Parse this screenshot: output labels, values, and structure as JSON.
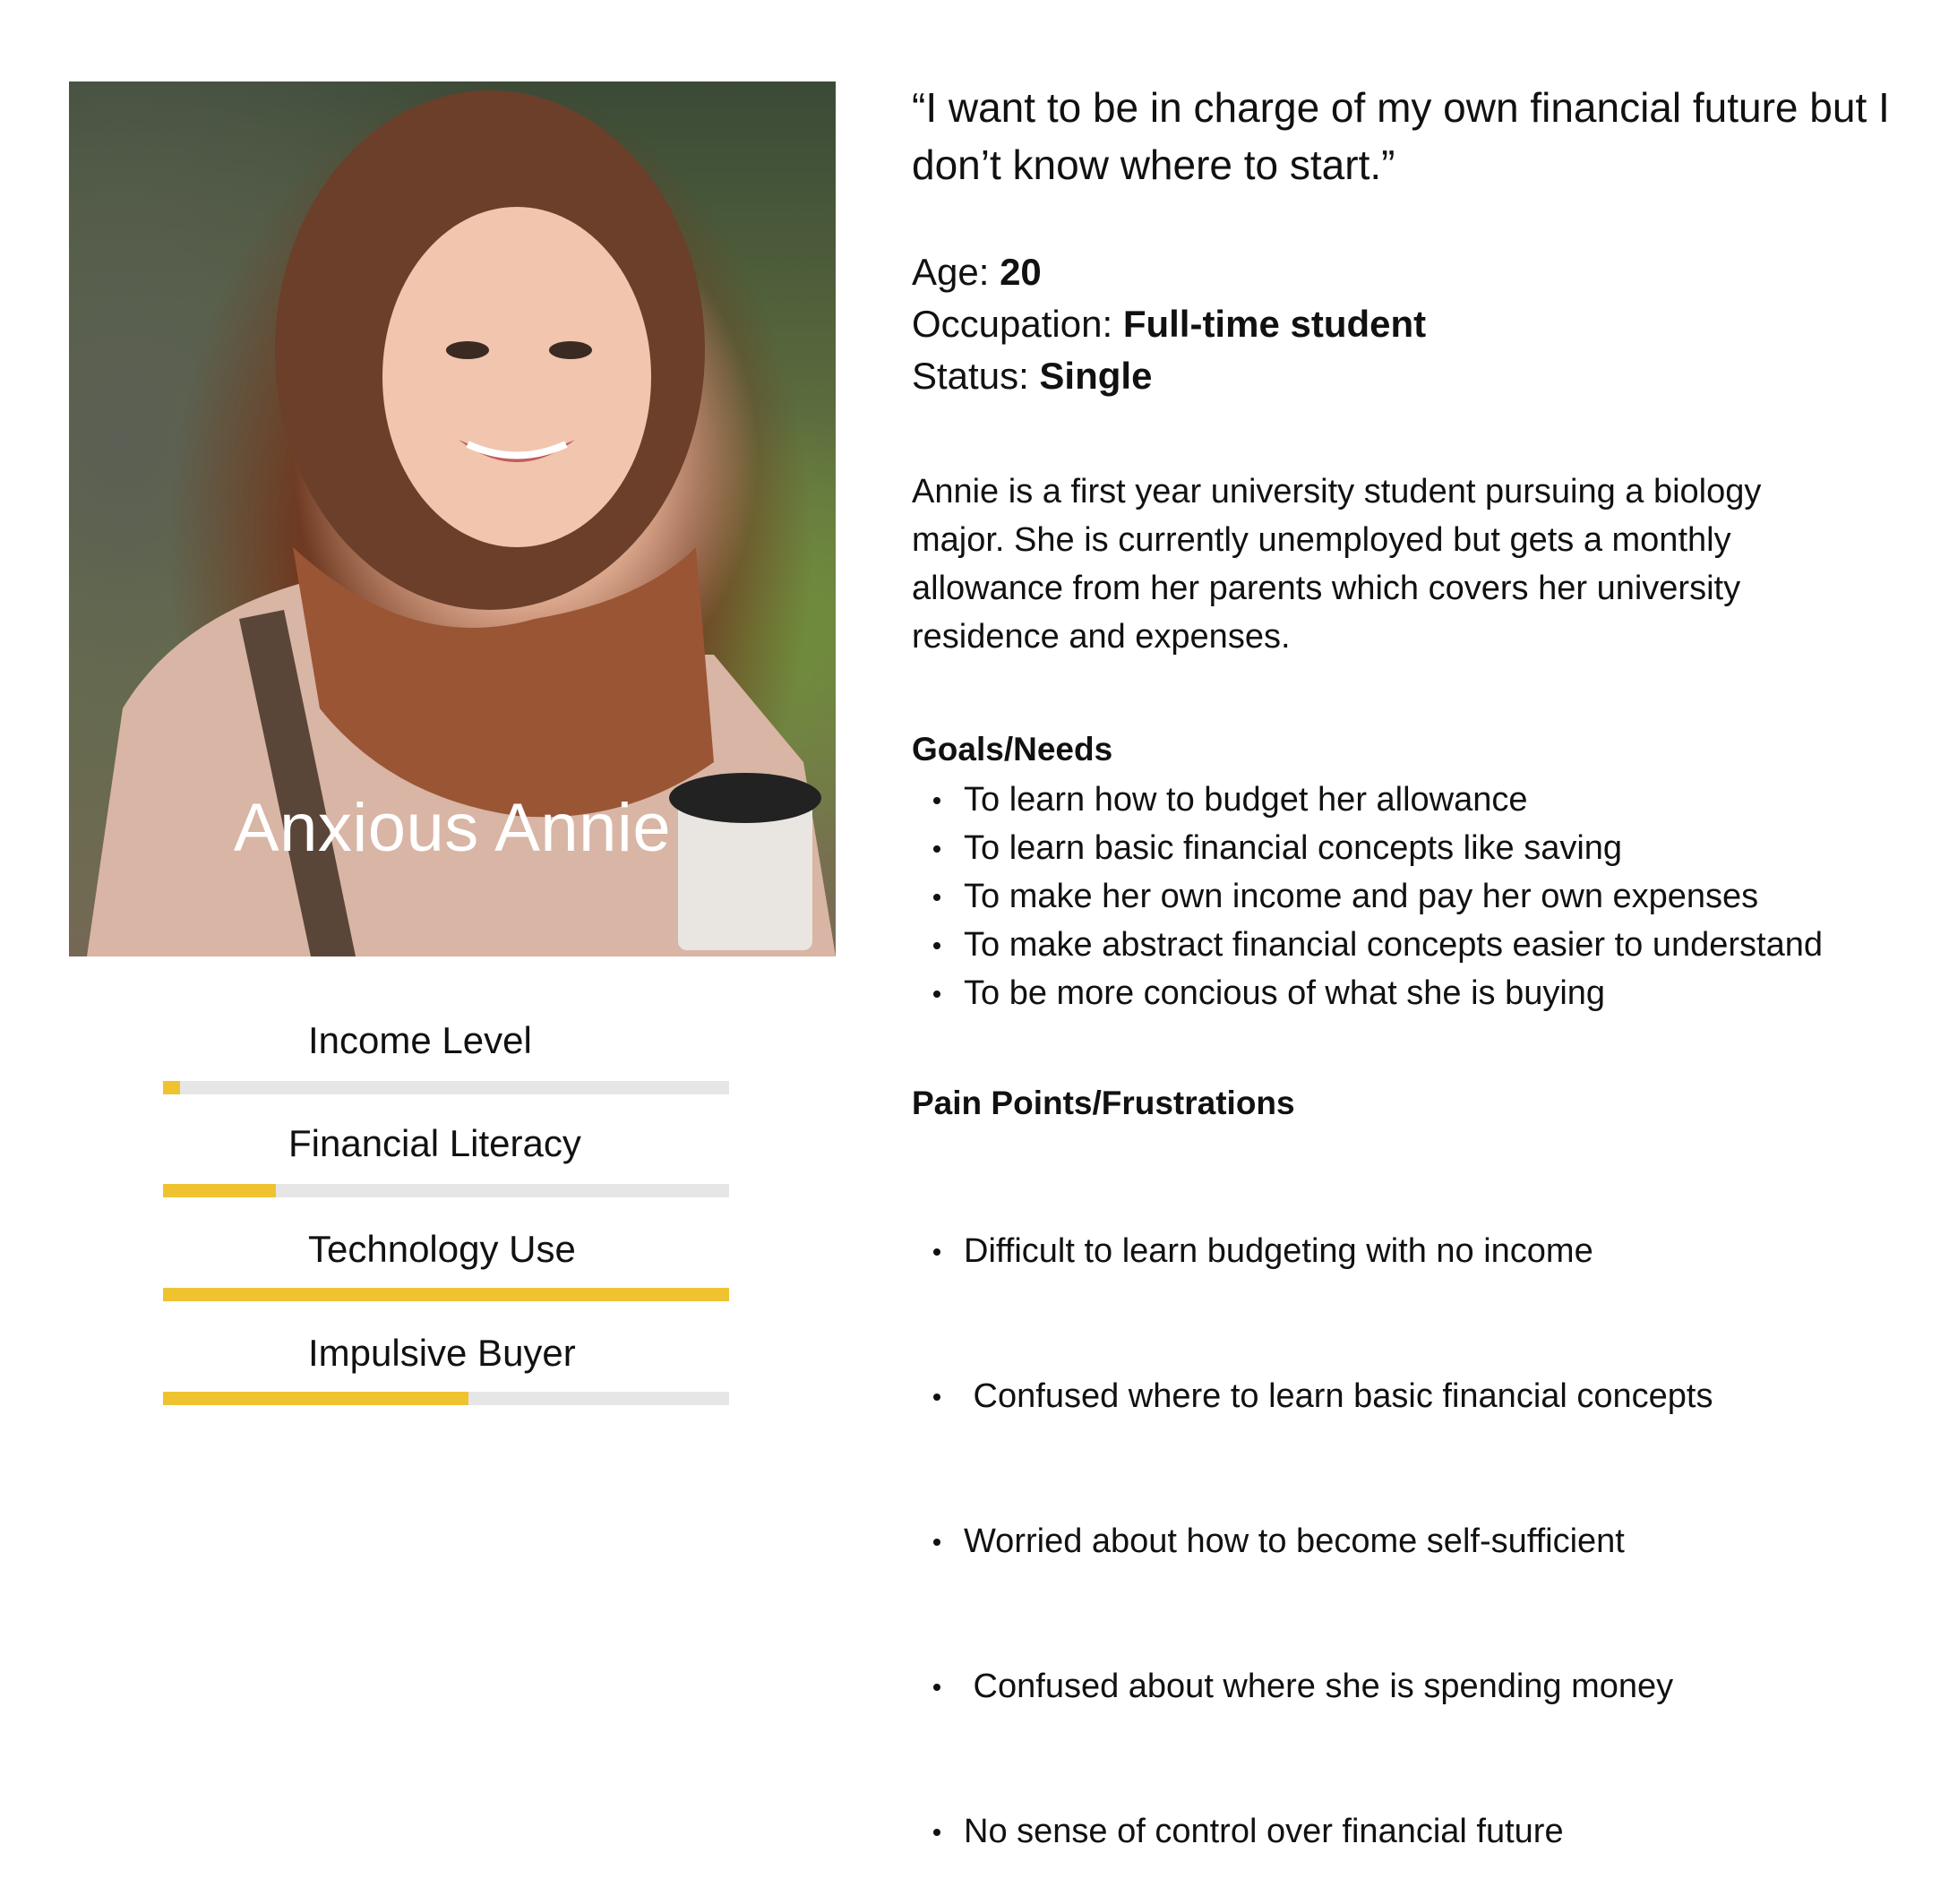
{
  "persona": {
    "name": "Anxious Annie",
    "photo_icon": "portrait-photo"
  },
  "meters": [
    {
      "label": "Income Level",
      "value": 0.03
    },
    {
      "label": "Financial Literacy",
      "value": 0.2
    },
    {
      "label": "Technology Use",
      "value": 1.0
    },
    {
      "label": "Impulsive Buyer",
      "value": 0.54
    }
  ],
  "quote": "“I want to be in charge of my own financial future but I don’t know where to start.”",
  "facts": {
    "age_label": "Age:",
    "age_value": "20",
    "occupation_label": "Occupation:",
    "occupation_value": "Full-time student",
    "status_label": "Status:",
    "status_value": "Single"
  },
  "bio": "Annie is a first year university student pursuing a biology major. She is currently unemployed but gets a monthly allowance from her parents which covers her university residence and expenses.",
  "goals": {
    "title": "Goals/Needs",
    "items": [
      "To learn how to budget her allowance",
      "To learn basic financial concepts like saving",
      "To make her own income and pay her own expenses",
      "To make abstract financial concepts easier to understand",
      "To be more concious of what she is buying"
    ]
  },
  "pains": {
    "title": "Pain Points/Frustrations",
    "items": [
      "Difficult to learn budgeting with no income",
      " Confused where to learn basic financial concepts",
      "Worried about how to become self-sufficient",
      " Confused about where she is spending money",
      "No sense of control over financial future"
    ]
  },
  "colors": {
    "meter_fill": "#efc330",
    "meter_track": "#e6e6e6"
  }
}
